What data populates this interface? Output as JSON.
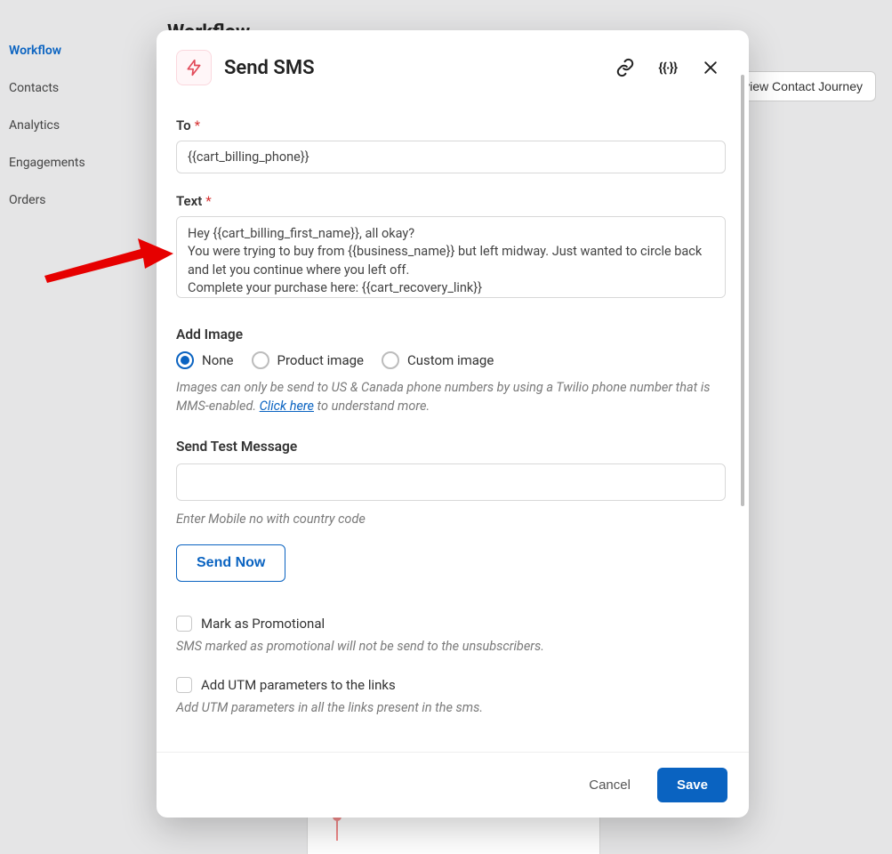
{
  "sidebar": {
    "items": [
      {
        "label": "Workflow",
        "active": true
      },
      {
        "label": "Contacts",
        "active": false
      },
      {
        "label": "Analytics",
        "active": false
      },
      {
        "label": "Engagements",
        "active": false
      },
      {
        "label": "Orders",
        "active": false
      }
    ]
  },
  "bg": {
    "page_title": "Workflow",
    "preview_btn": "Preview Contact Journey"
  },
  "modal": {
    "title": "Send SMS",
    "to_label": "To",
    "to_value": "{{cart_billing_phone}}",
    "text_label": "Text",
    "text_value": "Hey {{cart_billing_first_name}}, all okay?\nYou were trying to buy from {{business_name}} but left midway. Just wanted to circle back and let you continue where you left off.\nComplete your purchase here: {{cart_recovery_link}}",
    "add_image_label": "Add Image",
    "image_options": {
      "none": "None",
      "product": "Product image",
      "custom": "Custom image",
      "selected": "none"
    },
    "image_hint_pre": "Images can only be send to US & Canada phone numbers by using a Twilio phone number that is MMS-enabled. ",
    "image_hint_link": "Click here",
    "image_hint_post": " to understand more.",
    "send_test_label": "Send Test Message",
    "send_test_value": "",
    "send_test_placeholder": "",
    "send_test_hint": "Enter Mobile no with country code",
    "send_now": "Send Now",
    "mark_promo_label": "Mark as Promotional",
    "mark_promo_hint": "SMS marked as promotional will not be send to the unsubscribers.",
    "utm_label": "Add UTM parameters to the links",
    "utm_hint": "Add UTM parameters in all the links present in the sms.",
    "cancel": "Cancel",
    "save": "Save"
  }
}
